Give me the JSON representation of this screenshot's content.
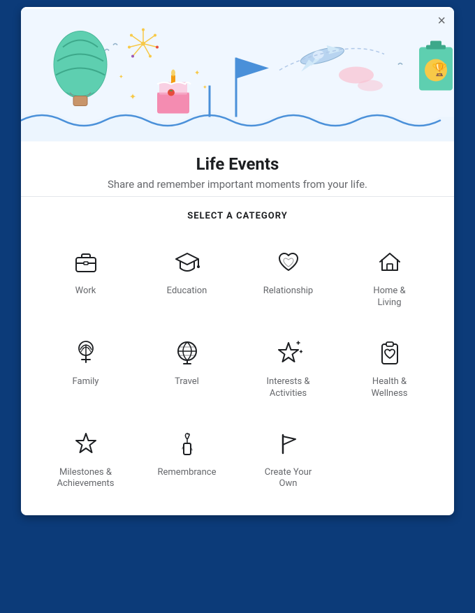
{
  "modal": {
    "close_label": "×",
    "title": "Life Events",
    "subtitle": "Share and remember important moments from your life.",
    "section_heading": "SELECT A CATEGORY"
  },
  "categories": [
    {
      "id": "work",
      "label": "Work",
      "icon": "briefcase"
    },
    {
      "id": "education",
      "label": "Education",
      "icon": "graduation"
    },
    {
      "id": "relationship",
      "label": "Relationship",
      "icon": "heart"
    },
    {
      "id": "home-living",
      "label": "Home &\nLiving",
      "icon": "home"
    },
    {
      "id": "family",
      "label": "Family",
      "icon": "tree"
    },
    {
      "id": "travel",
      "label": "Travel",
      "icon": "globe"
    },
    {
      "id": "interests-activities",
      "label": "Interests &\nActivities",
      "icon": "star-sparkle"
    },
    {
      "id": "health-wellness",
      "label": "Health &\nWellness",
      "icon": "clipboard-heart"
    },
    {
      "id": "milestones",
      "label": "Milestones &\nAchievements",
      "icon": "star"
    },
    {
      "id": "remembrance",
      "label": "Remembrance",
      "icon": "candle"
    },
    {
      "id": "create-own",
      "label": "Create Your\nOwn",
      "icon": "flag"
    }
  ]
}
